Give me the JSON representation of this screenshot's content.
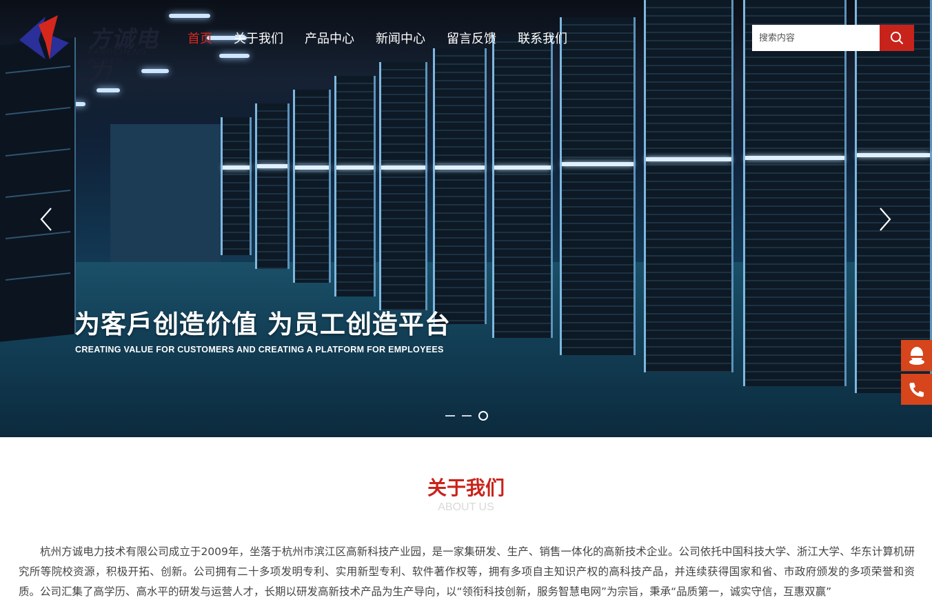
{
  "brand": {
    "name_cn": "方诚电力",
    "name_en": "FANGCHENG POWER"
  },
  "nav": {
    "items": [
      {
        "label": "首页",
        "active": true
      },
      {
        "label": "关于我们",
        "active": false
      },
      {
        "label": "产品中心",
        "active": false
      },
      {
        "label": "新闻中心",
        "active": false
      },
      {
        "label": "留言反馈",
        "active": false
      },
      {
        "label": "联系我们",
        "active": false
      }
    ]
  },
  "search": {
    "placeholder": "搜索内容",
    "value": ""
  },
  "hero": {
    "slogan_cn": "为客戶创造价值 为员工创造平台",
    "slogan_en": "CREATING VALUE FOR CUSTOMERS AND CREATING A PLATFORM FOR EMPLOYEES",
    "slide_count": 3,
    "active_slide": 3
  },
  "about": {
    "title": "关于我们",
    "subtitle": "ABOUT US",
    "text": "杭州方诚电力技术有限公司成立于2009年，坐落于杭州市滨江区高新科技产业园，是一家集研发、生产、销售一体化的高新技术企业。公司依托中国科技大学、浙江大学、华东计算机研究所等院校资源，积极开拓、创新。公司拥有二十多项发明专利、实用新型专利、软件著作权等，拥有多项自主知识产权的高科技产品，并连续获得国家和省、市政府颁发的多项荣誉和资质。公司汇集了高学历、高水平的研发与运营人才，长期以研发高新技术产品为生产导向，以“领衔科技创新，服务智慧电网”为宗旨，秉承“品质第一，诚实守信，互惠双赢”"
  },
  "colors": {
    "accent": "#c8231b",
    "side_button": "#d6451b"
  },
  "icons": [
    "search-icon",
    "chevron-left-icon",
    "chevron-right-icon",
    "qq-icon",
    "phone-icon"
  ]
}
